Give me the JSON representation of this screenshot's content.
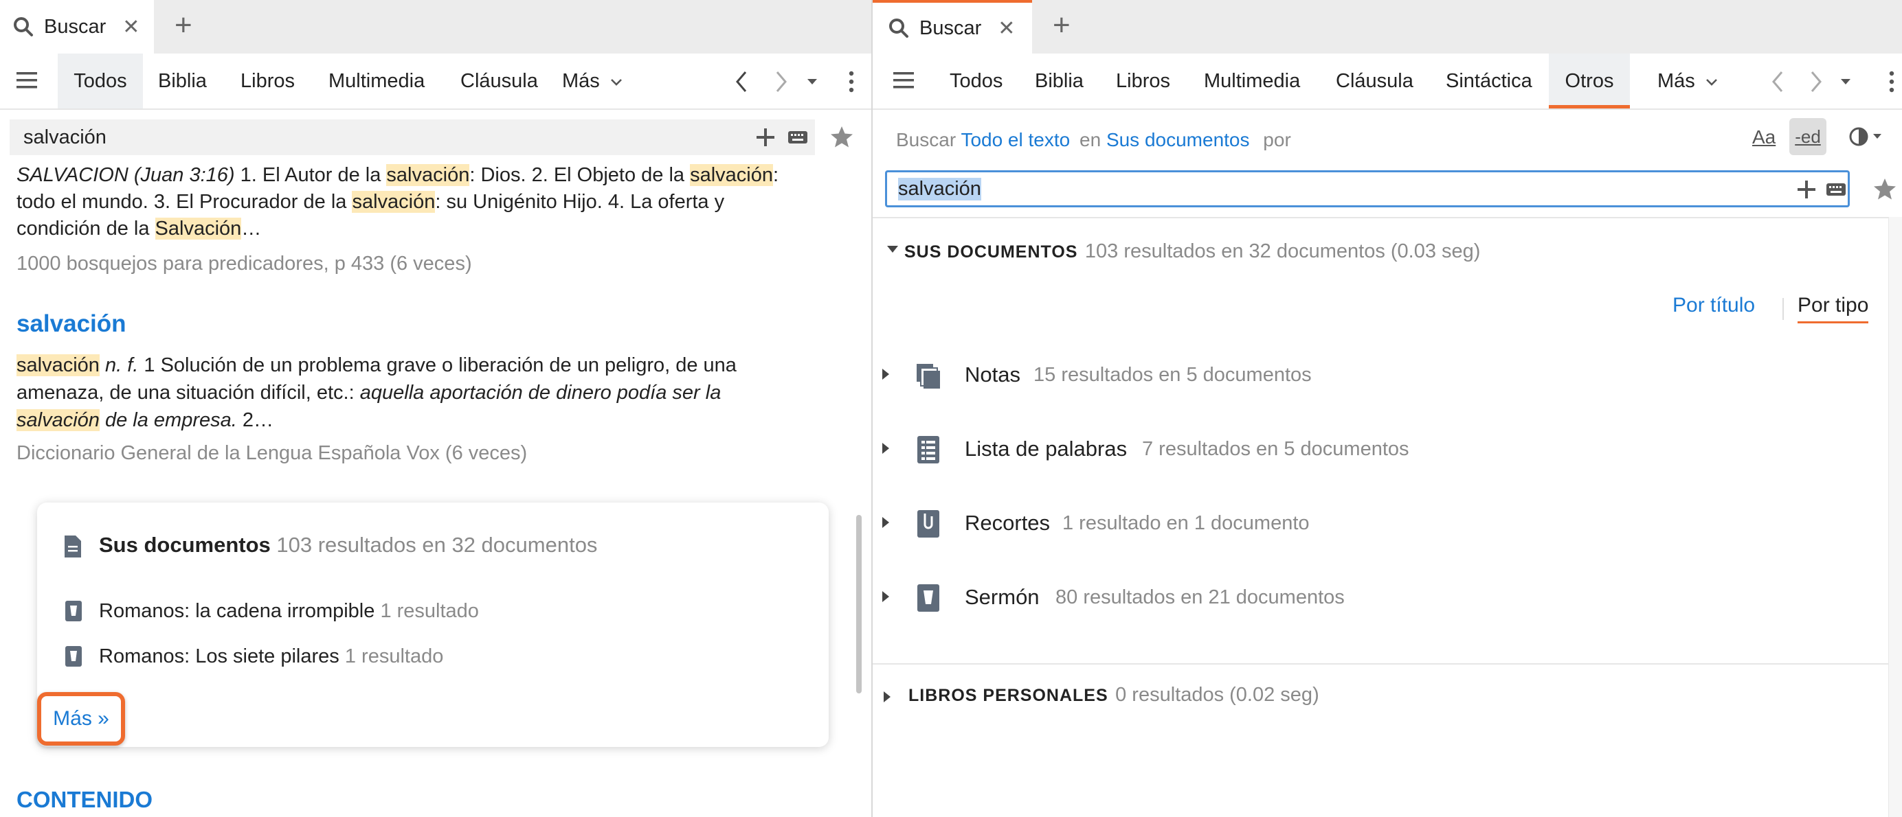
{
  "left": {
    "tab": {
      "icon": "search-icon",
      "label": "Buscar",
      "close": "✕",
      "new_tab": "+"
    },
    "nav": {
      "items": [
        "Todos",
        "Biblia",
        "Libros",
        "Multimedia",
        "Cláusula"
      ],
      "more": "Más"
    },
    "search": {
      "value": "salvación"
    },
    "results": {
      "r1": {
        "p1": "SALVACION (Juan 3:16)",
        "p2": " 1. El Autor de la ",
        "p3": "salvación",
        "p4": ": Dios. 2. El Objeto de la ",
        "p5": "salvación",
        "p6": ":",
        "p7": "todo el mundo. 3. El Procurador de la ",
        "p8": "salvación",
        "p9": ": su Unigénito Hijo. 4. La oferta y",
        "p10": "condición de la ",
        "p11": "Salvación",
        "p12": "…",
        "source": "1000 bosquejos para predicadores, p 433 (6 veces)"
      },
      "r2": {
        "title": "salvación",
        "p1": "salvación",
        "p2": " n. f.",
        "p3": " 1 Solución de un problema grave o liberación de un peligro, de una",
        "p4": "amenaza, de una situación difícil, etc.: ",
        "p5": "aquella aportación de dinero podía ser la",
        "p6": "salvación",
        "p7": " de la empresa.",
        "p8": " 2…",
        "source": "Diccionario General de la Lengua Española Vox (6 veces)"
      }
    },
    "card": {
      "title": "Sus documentos",
      "count": "103 resultados en 32 documentos",
      "items": [
        {
          "title": "Romanos: la cadena irrompible",
          "count": "1 resultado"
        },
        {
          "title": "Romanos: Los siete pilares",
          "count": "1 resultado"
        }
      ],
      "more": "Más »"
    },
    "section_heading": "CONTENIDO"
  },
  "right": {
    "tab": {
      "icon": "search-icon",
      "label": "Buscar",
      "close": "✕",
      "new_tab": "+"
    },
    "nav": {
      "items": [
        "Todos",
        "Biblia",
        "Libros",
        "Multimedia",
        "Cláusula",
        "Sintáctica",
        "Otros"
      ],
      "more": "Más",
      "active": "Otros"
    },
    "query_line": {
      "buscar": "Buscar",
      "scope": "Todo el texto",
      "en": "en",
      "collection": "Sus documentos",
      "por": "por"
    },
    "search": {
      "value": "salvación"
    },
    "toolbar": {
      "case": "Aa",
      "ed": "-ed"
    },
    "section": {
      "title": "SUS DOCUMENTOS",
      "summary": "103 resultados en 32 documentos (0.03 seg)",
      "sort_title": "Por título",
      "sort_type": "Por tipo"
    },
    "groups": [
      {
        "label": "Notas",
        "count": "15 resultados en 5 documentos",
        "icon": "notes-icon"
      },
      {
        "label": "Lista de palabras",
        "count": "7 resultados en 5 documentos",
        "icon": "word-list-icon"
      },
      {
        "label": "Recortes",
        "count": "1 resultado en 1 documento",
        "icon": "clippings-icon"
      },
      {
        "label": "Sermón",
        "count": "80 resultados en 21 documentos",
        "icon": "sermon-icon"
      }
    ],
    "personal": {
      "title": "LIBROS PERSONALES",
      "summary": "0 resultados (0.02 seg)"
    }
  },
  "colors": {
    "accent": "#ef6c2f",
    "link": "#1a7ad4",
    "highlight": "#fde9b8"
  }
}
